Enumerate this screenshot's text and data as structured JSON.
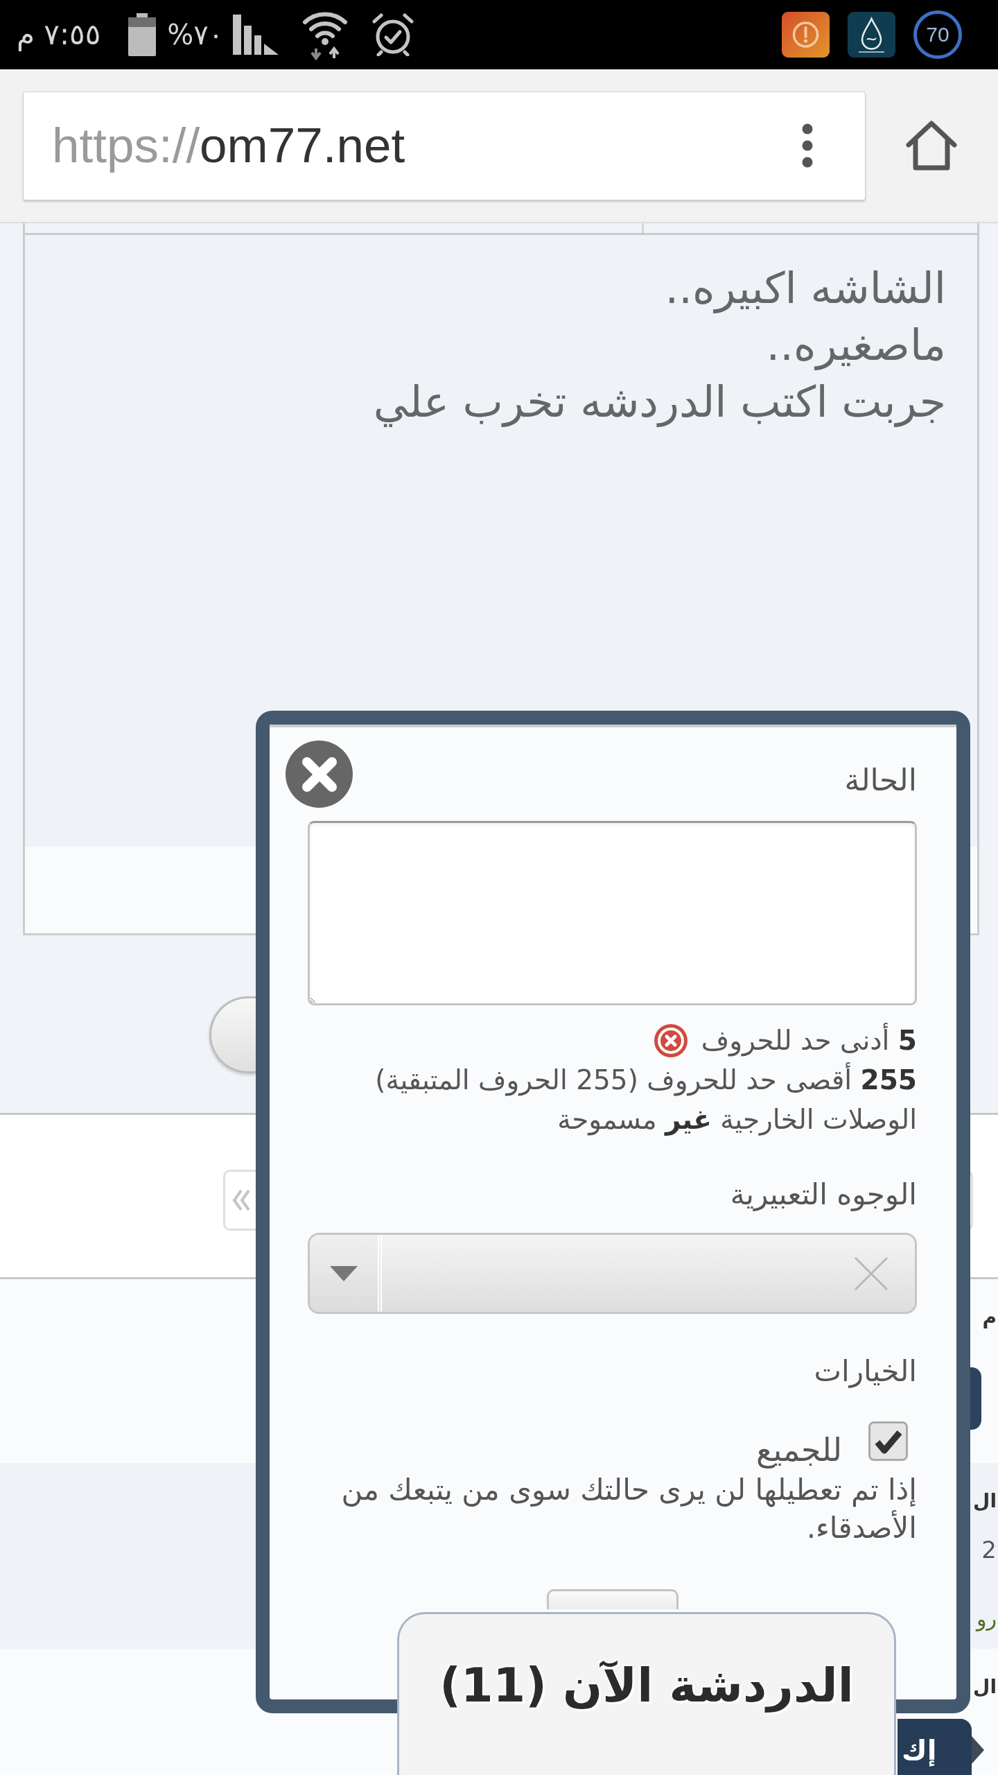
{
  "status_bar": {
    "time": "٧:٥٥ م",
    "battery": "%٧٠",
    "notifications": [
      {
        "kind": "alert"
      },
      {
        "kind": "app"
      },
      {
        "kind": "counter",
        "text": "70"
      }
    ]
  },
  "browser": {
    "url_scheme": "https://",
    "url_host": "om77.net"
  },
  "post": {
    "lines": [
      "الشاشه اكبيره..",
      "ماصغيره..",
      "جربت اكتب الدردشه تخرب علي"
    ]
  },
  "side_rows": [
    {
      "items": [
        {
          "kind": "title",
          "text": "م"
        },
        {
          "kind": "button"
        }
      ]
    },
    {
      "items": [
        {
          "kind": "title",
          "text": "ال"
        },
        {
          "kind": "meta",
          "text": "2"
        },
        {
          "kind": "link",
          "text": "رو"
        }
      ]
    },
    {
      "items": [
        {
          "kind": "title",
          "text": "ال"
        }
      ]
    }
  ],
  "write_button": {
    "label": "إك"
  },
  "status_dialog": {
    "status_label": "الحالة",
    "rules": [
      {
        "text": "**5** أدنى حد للحروف",
        "error": true
      },
      {
        "text": "**255** أقصى حد للحروف (255 الحروف المتبقية)",
        "error": false
      },
      {
        "text": "الوصلات الخارجية **غير** مسموحة",
        "error": false
      }
    ],
    "smilies_label": "الوجوه التعبيرية",
    "options_label": "الخيارات",
    "public_option": {
      "label": "للجميع",
      "checked": true
    },
    "public_hint": "إذا تم تعطيلها لن يرى حالتك سوى من يتبعك من الأصدقاء."
  },
  "chat_tab": {
    "label": "الدردشة الآن (11)"
  }
}
